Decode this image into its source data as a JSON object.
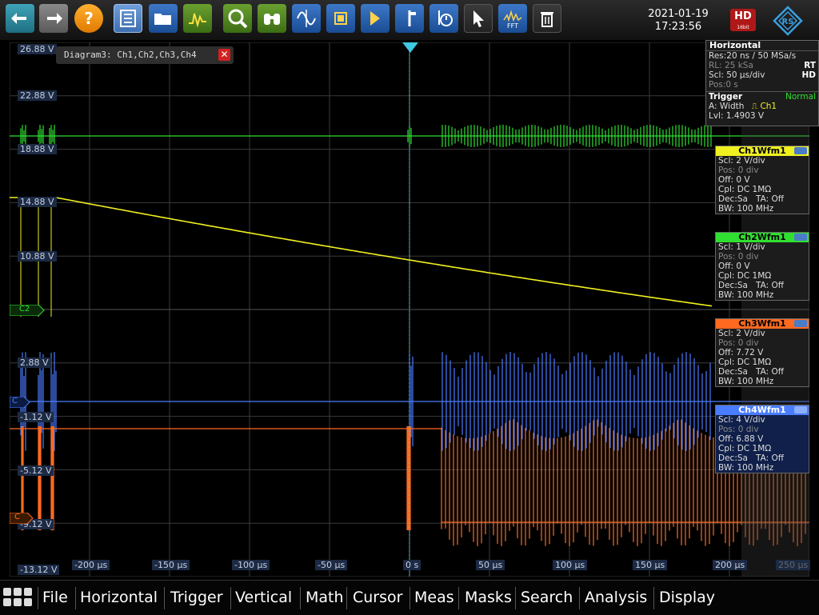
{
  "datetime": {
    "date": "2021-01-19",
    "time": "17:23:56"
  },
  "toolbar": {
    "items": [
      {
        "name": "undo-icon",
        "color": "#3fa3b8"
      },
      {
        "name": "redo-icon",
        "color": "#8a8a8a"
      },
      {
        "name": "help-icon",
        "color": "#ffb030"
      },
      {
        "name": "signal-bar-icon",
        "color": "#3d78c8"
      },
      {
        "name": "open-folder-icon",
        "color": "#3d78c8"
      },
      {
        "name": "autoset-icon",
        "color": "#6aa030"
      },
      {
        "name": "zoom-icon",
        "color": "#6aa030"
      },
      {
        "name": "binoculars-icon",
        "color": "#6aa030"
      },
      {
        "name": "waveform-cursor-icon",
        "color": "#3d78c8"
      },
      {
        "name": "chip-icon",
        "color": "#3d78c8"
      },
      {
        "name": "trigger-marker-icon",
        "color": "#3d78c8"
      },
      {
        "name": "vertical-marker-icon",
        "color": "#3d78c8"
      },
      {
        "name": "history-icon",
        "color": "#3d78c8"
      },
      {
        "name": "pointer-icon",
        "color": "#3d78c8"
      },
      {
        "name": "fft-icon",
        "color": "#3d78c8"
      },
      {
        "name": "trash-icon",
        "color": "#3a3a3a"
      }
    ],
    "fft_label": "FFT"
  },
  "hd_badge": {
    "label": "HD",
    "sub": "16bit"
  },
  "diagram": {
    "title": "Diagram3: Ch1,Ch2,Ch3,Ch4",
    "close": "✕"
  },
  "y_labels": [
    "26.88 V",
    "22.88 V",
    "18.88 V",
    "14.88 V",
    "10.88 V",
    "2.88 V",
    "-1.12 V",
    "-5.12 V",
    "-9.12 V",
    "-13.12 V"
  ],
  "x_labels": [
    "-200 µs",
    "-150 µs",
    "-100 µs",
    "-50 µs",
    "0 s",
    "50 µs",
    "100 µs",
    "150 µs",
    "200 µs",
    "250 µs"
  ],
  "markers": {
    "c2": "C2",
    "c3": "C",
    "c4": "C"
  },
  "horizontal": {
    "title": "Horizontal",
    "res": "Res:20 ns / 50 MSa/s",
    "rl": "RL: 25 kSa",
    "rt": "RT",
    "scl": "Scl: 50 µs/div",
    "hd": "HD",
    "pos": "Pos:0 s"
  },
  "trigger": {
    "title": "Trigger",
    "mode": "Normal",
    "a": "A:  Width",
    "source": "Ch1",
    "lvl": "Lvl: 1.4903 V"
  },
  "channels": [
    {
      "title": "Ch1Wfm1",
      "color": "#f0f020",
      "scl": "Scl: 2 V/div",
      "pos": "Pos: 0 div",
      "off": "Off: 0 V",
      "cpl": "Cpl: DC 1MΩ",
      "dec": "Dec:Sa",
      "ta": "TA: Off",
      "bw": "BW: 100 MHz"
    },
    {
      "title": "Ch2Wfm1",
      "color": "#30e030",
      "scl": "Scl: 1 V/div",
      "pos": "Pos: 0 div",
      "off": "Off: 0 V",
      "cpl": "Cpl: DC 1MΩ",
      "dec": "Dec:Sa",
      "ta": "TA: Off",
      "bw": "BW: 100 MHz"
    },
    {
      "title": "Ch3Wfm1",
      "color": "#ff6a20",
      "scl": "Scl: 2 V/div",
      "pos": "Pos: 0 div",
      "off": "Off: 7.72 V",
      "cpl": "Cpl: DC 1MΩ",
      "dec": "Dec:Sa",
      "ta": "TA: Off",
      "bw": "BW: 100 MHz"
    },
    {
      "title": "Ch4Wfm1",
      "color": "#4a7cff",
      "scl": "Scl: 4 V/div",
      "pos": "Pos: 0 div",
      "off": "Off: 6.88 V",
      "cpl": "Cpl: DC 1MΩ",
      "dec": "Dec:Sa",
      "ta": "TA: Off",
      "bw": "BW: 100 MHz"
    }
  ],
  "menu": [
    "File",
    "Horizontal",
    "Trigger",
    "Vertical",
    "Math",
    "Cursor",
    "Meas",
    "Masks",
    "Search",
    "Analysis",
    "Display"
  ],
  "colors": {
    "ch1": "#f0f020",
    "ch2": "#30e030",
    "ch3": "#ff6a20",
    "ch4": "#4a7cff",
    "grid": "#3a3a3a",
    "accent": "#1b6fd0"
  }
}
